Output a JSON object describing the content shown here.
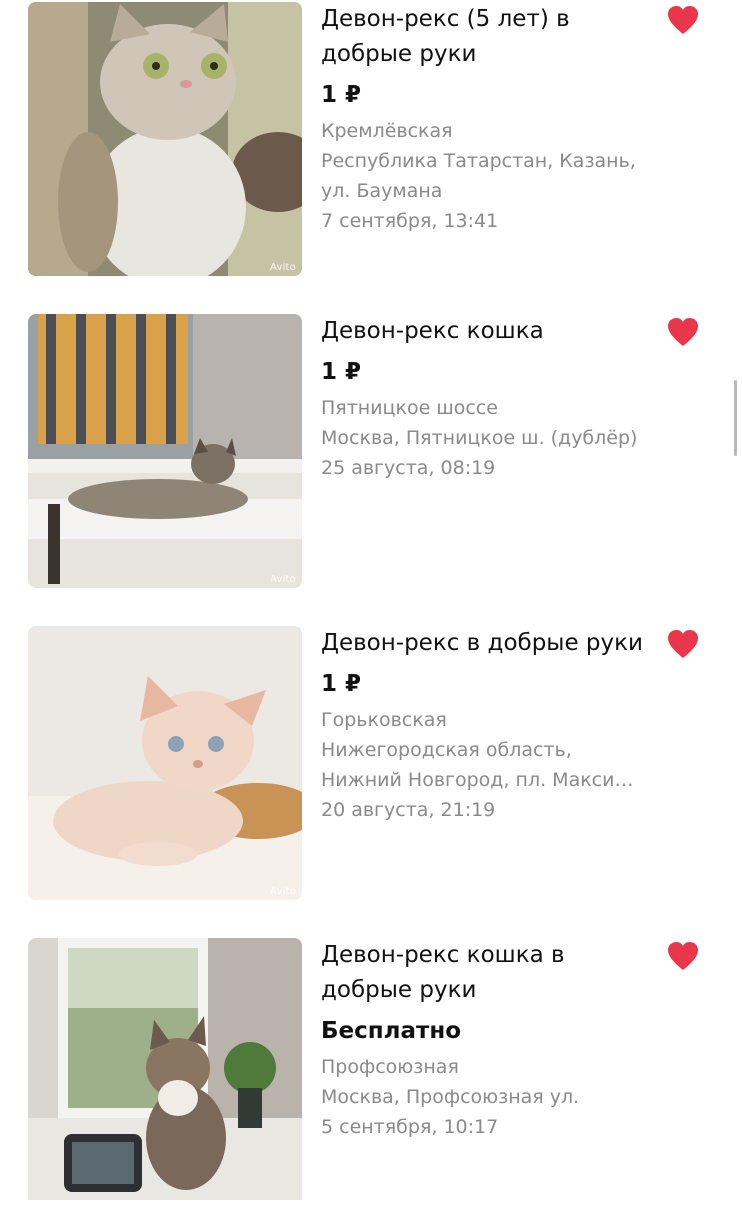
{
  "watermark": "Avito",
  "colors": {
    "favorite_heart": "#e8364b",
    "meta_text": "#8a8a8a",
    "title_text": "#111111"
  },
  "listings": [
    {
      "title": "Девон-рекс (5 лет) в добрые руки",
      "price": "1 ₽",
      "station": "Кремлёвская",
      "address": "Республика Татарстан, Казань, ул. Баумана",
      "date": "7 сентября, 13:41",
      "favorite_icon": "heart-filled-icon"
    },
    {
      "title": "Девон-рекс кошка",
      "price": "1 ₽",
      "station": "Пятницкое шоссе",
      "address": "Москва, Пятницкое ш. (дублёр)",
      "date": "25 августа, 08:19",
      "favorite_icon": "heart-filled-icon"
    },
    {
      "title": "Девон-рекс в добрые руки",
      "price": "1 ₽",
      "station": "Горьковская",
      "address": "Нижегородская область, Нижний Новгород, пл. Макси…",
      "date": "20 августа, 21:19",
      "favorite_icon": "heart-filled-icon"
    },
    {
      "title": "Девон-рекс кошка в добрые руки",
      "price": "Бесплатно",
      "station": "Профсоюзная",
      "address": "Москва, Профсоюзная ул.",
      "date": "5 сентября, 10:17",
      "favorite_icon": "heart-filled-icon"
    }
  ]
}
